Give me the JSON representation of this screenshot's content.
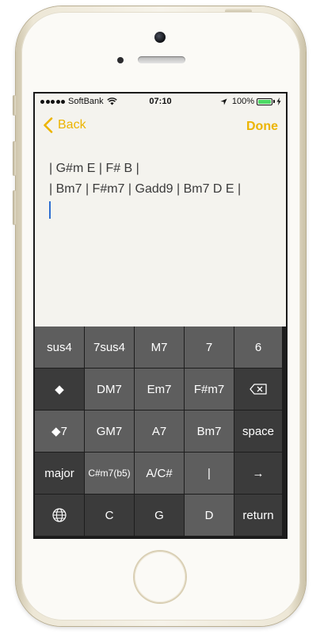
{
  "status_bar": {
    "carrier": "SoftBank",
    "time": "07:10",
    "battery": "100%"
  },
  "nav": {
    "back_label": "Back",
    "done_label": "Done",
    "accent_color": "#ECB400"
  },
  "editor": {
    "lines": [
      "| G#m E | F# B |",
      "| Bm7 | F#m7 | Gadd9 | Bm7 D E |"
    ]
  },
  "keyboard": {
    "rows": [
      [
        "sus4",
        "7sus4",
        "M7",
        "7",
        "6"
      ],
      [
        "◆",
        "DM7",
        "Em7",
        "F#m7",
        "⌫"
      ],
      [
        "◆7",
        "GM7",
        "A7",
        "Bm7",
        "space"
      ],
      [
        "major",
        "C#m7(b5)",
        "A/C#",
        "|",
        "→"
      ],
      [
        "",
        "C",
        "G",
        "D",
        "return"
      ]
    ],
    "icons": {
      "globe_key": "globe-icon",
      "delete_key": "backspace-icon",
      "arrow_key": "arrow-right-icon"
    }
  }
}
